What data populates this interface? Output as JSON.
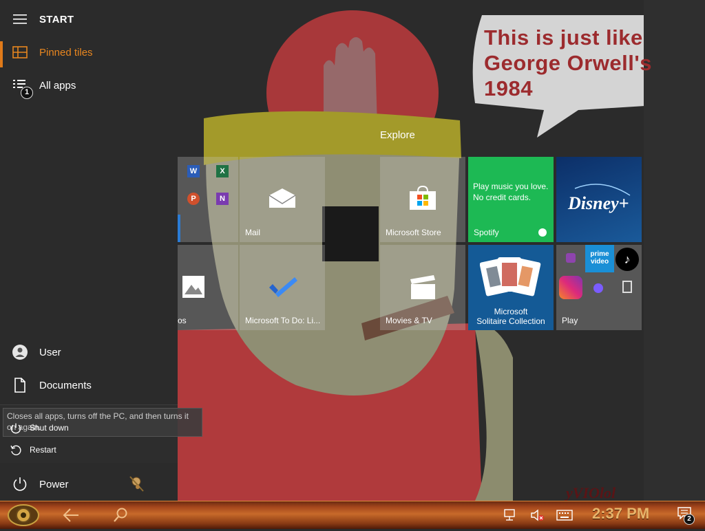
{
  "start_menu": {
    "title": "START",
    "nav": {
      "pinned_tiles": "Pinned tiles",
      "all_apps": "All apps",
      "all_apps_badge": "1"
    },
    "bottom": {
      "user": "User",
      "documents": "Documents",
      "power": "Power"
    },
    "power_menu": {
      "tooltip": "Closes all apps, turns off the PC, and then turns it on again.",
      "shut_down": "Shut down",
      "restart": "Restart"
    }
  },
  "tiles": {
    "group_name": "Explore",
    "mail": "Mail",
    "microsoft_store": "Microsoft Store",
    "spotify": {
      "promo_line1": "Play music you love.",
      "promo_line2": "No credit cards.",
      "label": "Spotify",
      "color": "#1db954"
    },
    "disney": {
      "logo_text": "Disney+",
      "color": "#0d3b73"
    },
    "photos_partial": "os",
    "todo": "Microsoft To Do: Li...",
    "movies": "Movies & TV",
    "solitaire": {
      "label_line1": "Microsoft",
      "label_line2": "Solitaire Collection",
      "color": "#145a96"
    },
    "play": {
      "label": "Play",
      "prime_text": "prime video"
    }
  },
  "wallpaper": {
    "speech_line1": "This is just like",
    "speech_line2": "George Orwell's",
    "speech_line3": "1984",
    "watermark": "yVIOlol"
  },
  "taskbar": {
    "clock": "2:37 PM",
    "notification_count": "2",
    "accent": "#c86a2a"
  }
}
